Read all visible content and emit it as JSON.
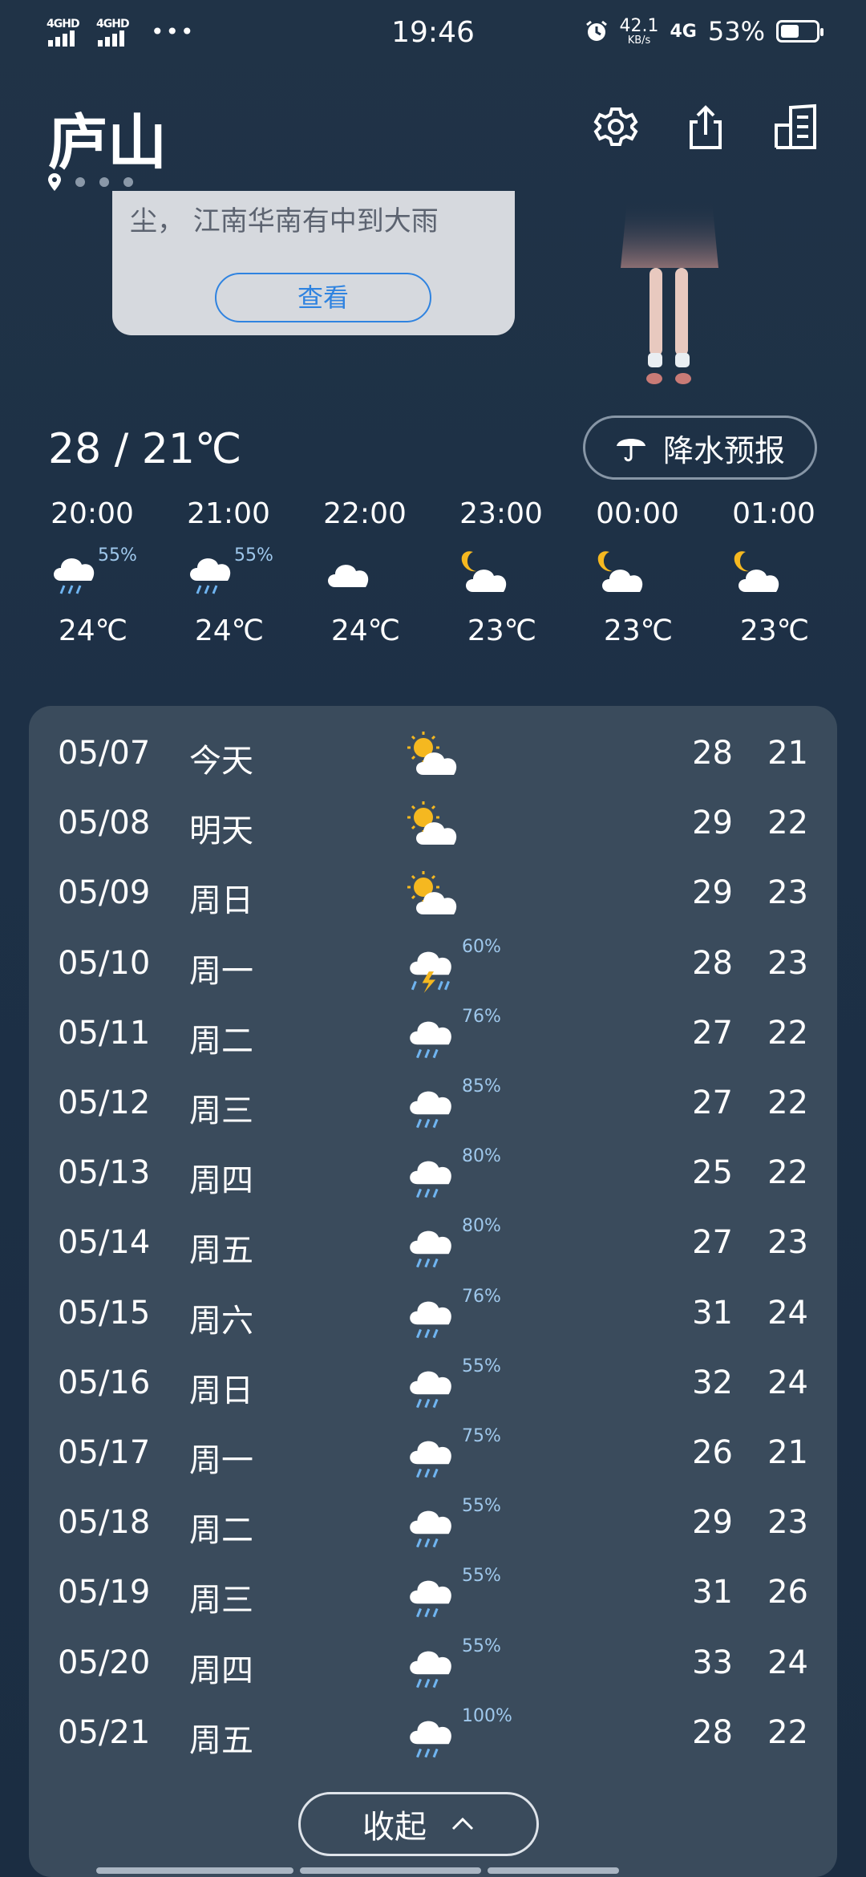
{
  "status_bar": {
    "sim1": "4GHD",
    "sim2": "4GHD",
    "more": "•••",
    "time": "19:46",
    "speed_value": "42.1",
    "speed_unit": "KB/s",
    "network": "4G",
    "battery_pct": "53%",
    "battery_level": 0.53
  },
  "header": {
    "city": "庐山",
    "icons": [
      "gear-icon",
      "share-icon",
      "city-manage-icon"
    ]
  },
  "popup": {
    "text": "尘，  江南华南有中到大雨",
    "button": "查看"
  },
  "today_range": "28 / 21℃",
  "precip_button": "降水预报",
  "hourly": [
    {
      "time": "20:00",
      "icon": "rain-cloud-icon",
      "pct": "55%",
      "temp": "24℃"
    },
    {
      "time": "21:00",
      "icon": "rain-cloud-icon",
      "pct": "55%",
      "temp": "24℃"
    },
    {
      "time": "22:00",
      "icon": "cloud-icon",
      "pct": "",
      "temp": "24℃"
    },
    {
      "time": "23:00",
      "icon": "moon-cloud-icon",
      "pct": "",
      "temp": "23℃"
    },
    {
      "time": "00:00",
      "icon": "moon-cloud-icon",
      "pct": "",
      "temp": "23℃"
    },
    {
      "time": "01:00",
      "icon": "moon-cloud-icon",
      "pct": "",
      "temp": "23℃"
    }
  ],
  "daily": [
    {
      "date": "05/07",
      "day": "今天",
      "icon": "sun-cloud-icon",
      "pct": "",
      "hi": "28",
      "lo": "21"
    },
    {
      "date": "05/08",
      "day": "明天",
      "icon": "sun-cloud-icon",
      "pct": "",
      "hi": "29",
      "lo": "22"
    },
    {
      "date": "05/09",
      "day": "周日",
      "icon": "sun-cloud-icon",
      "pct": "",
      "hi": "29",
      "lo": "23"
    },
    {
      "date": "05/10",
      "day": "周一",
      "icon": "thunder-rain-icon",
      "pct": "60%",
      "hi": "28",
      "lo": "23"
    },
    {
      "date": "05/11",
      "day": "周二",
      "icon": "rain-cloud-icon",
      "pct": "76%",
      "hi": "27",
      "lo": "22"
    },
    {
      "date": "05/12",
      "day": "周三",
      "icon": "rain-cloud-icon",
      "pct": "85%",
      "hi": "27",
      "lo": "22"
    },
    {
      "date": "05/13",
      "day": "周四",
      "icon": "rain-cloud-icon",
      "pct": "80%",
      "hi": "25",
      "lo": "22"
    },
    {
      "date": "05/14",
      "day": "周五",
      "icon": "rain-cloud-icon",
      "pct": "80%",
      "hi": "27",
      "lo": "23"
    },
    {
      "date": "05/15",
      "day": "周六",
      "icon": "rain-cloud-icon",
      "pct": "76%",
      "hi": "31",
      "lo": "24"
    },
    {
      "date": "05/16",
      "day": "周日",
      "icon": "rain-cloud-icon",
      "pct": "55%",
      "hi": "32",
      "lo": "24"
    },
    {
      "date": "05/17",
      "day": "周一",
      "icon": "rain-cloud-icon",
      "pct": "75%",
      "hi": "26",
      "lo": "21"
    },
    {
      "date": "05/18",
      "day": "周二",
      "icon": "rain-cloud-icon",
      "pct": "55%",
      "hi": "29",
      "lo": "23"
    },
    {
      "date": "05/19",
      "day": "周三",
      "icon": "rain-cloud-icon",
      "pct": "55%",
      "hi": "31",
      "lo": "26"
    },
    {
      "date": "05/20",
      "day": "周四",
      "icon": "rain-cloud-icon",
      "pct": "55%",
      "hi": "33",
      "lo": "24"
    },
    {
      "date": "05/21",
      "day": "周五",
      "icon": "rain-cloud-icon",
      "pct": "100%",
      "hi": "28",
      "lo": "22"
    }
  ],
  "collapse_button": "收起",
  "colors": {
    "background": "#1d3046",
    "panel": "#3a4b5c",
    "accent_blue": "#2f83e0",
    "precip_pct": "#9fc8ec",
    "sun": "#f5b820"
  }
}
